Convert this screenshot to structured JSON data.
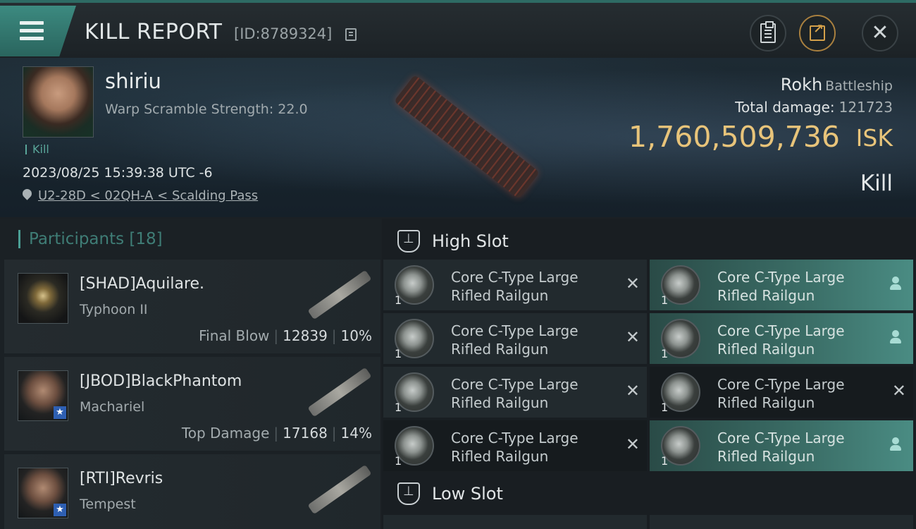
{
  "header": {
    "title": "KILL REPORT",
    "report_id": "[ID:8789324]"
  },
  "victim": {
    "name": "shiriu",
    "warp_scramble": "Warp Scramble Strength: 22.0",
    "tag": "Kill",
    "datetime": "2023/08/25 15:39:38 UTC -6",
    "location": "U2-28D < 02QH-A < Scalding Pass",
    "ship_name": "Rokh",
    "ship_class": "Battleship",
    "total_damage_label": "Total damage:",
    "total_damage_value": "121723",
    "isk_value": "1,760,509,736",
    "isk_unit": "ISK",
    "status": "Kill"
  },
  "participants": {
    "label": "Participants",
    "count": "[18]",
    "rows": [
      {
        "name": "[SHAD]Aquilare.",
        "ship": "Typhoon II",
        "role": "Final Blow",
        "damage": "12839",
        "percent": "10%"
      },
      {
        "name": "[JBOD]BlackPhantom",
        "ship": "Machariel",
        "role": "Top Damage",
        "damage": "17168",
        "percent": "14%"
      },
      {
        "name": "[RTI]Revris",
        "ship": "Tempest",
        "role": "",
        "damage": "",
        "percent": ""
      }
    ]
  },
  "slots": {
    "high_title": "High Slot",
    "low_title": "Low Slot",
    "high_modules": [
      {
        "name_line1": "Core C-Type Large",
        "name_line2": "Rifled Railgun",
        "qty": "1",
        "state": "destroyed"
      },
      {
        "name_line1": "Core C-Type Large",
        "name_line2": "Rifled Railgun",
        "qty": "1",
        "state": "dropped"
      },
      {
        "name_line1": "Core C-Type Large",
        "name_line2": "Rifled Railgun",
        "qty": "1",
        "state": "destroyed"
      },
      {
        "name_line1": "Core C-Type Large",
        "name_line2": "Rifled Railgun",
        "qty": "1",
        "state": "dropped"
      },
      {
        "name_line1": "Core C-Type Large",
        "name_line2": "Rifled Railgun",
        "qty": "1",
        "state": "destroyed"
      },
      {
        "name_line1": "Core C-Type Large",
        "name_line2": "Rifled Railgun",
        "qty": "1",
        "state": "destroyed"
      },
      {
        "name_line1": "Core C-Type Large",
        "name_line2": "Rifled Railgun",
        "qty": "1",
        "state": "destroyed"
      },
      {
        "name_line1": "Core C-Type Large",
        "name_line2": "Rifled Railgun",
        "qty": "1",
        "state": "dropped"
      }
    ]
  },
  "icons": {
    "menu": "menu-icon",
    "copy": "copy-icon",
    "clipboard": "clipboard-icon",
    "share": "share-icon",
    "close": "close-icon",
    "location": "location-pin-icon",
    "slot": "slot-icon",
    "destroyed": "x-icon",
    "dropped": "person-icon"
  },
  "colors": {
    "accent": "#3c8a80",
    "isk": "#e8c47a",
    "owned_module": "#3b6e67"
  }
}
